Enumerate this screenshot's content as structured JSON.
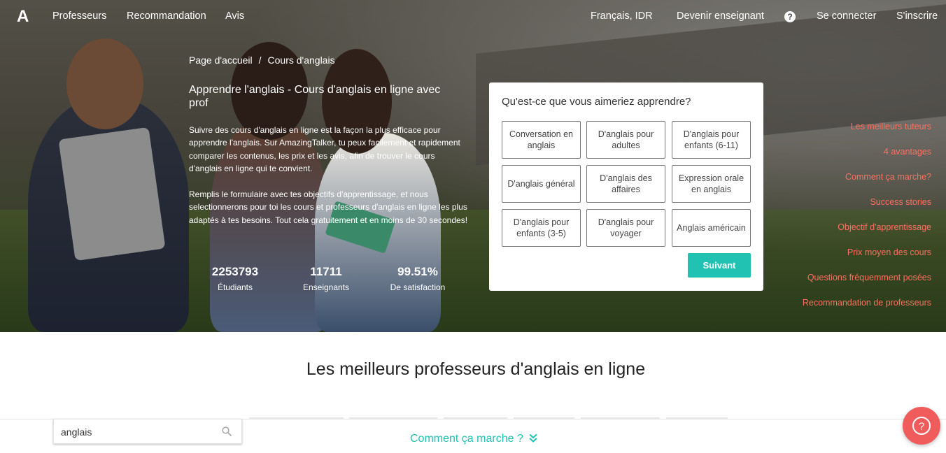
{
  "nav": {
    "logo": "A",
    "links": [
      "Professeurs",
      "Recommandation",
      "Avis"
    ],
    "language": "Français,  IDR",
    "become_teacher": "Devenir enseignant",
    "help": "?",
    "login": "Se connecter",
    "signup": "S'inscrire"
  },
  "breadcrumb": {
    "home": "Page d'accueil",
    "separator": "/",
    "current": "Cours d'anglais"
  },
  "hero": {
    "title": "Apprendre l'anglais - Cours d'anglais en ligne avec prof",
    "paragraph1": "Suivre des cours d'anglais en ligne est la façon la plus efficace pour apprendre l'anglais. Sur AmazingTalker, tu peux facilement et rapidement comparer les contenus, les prix et les avis, afin de trouver le cours d'anglais en ligne qui te convient.",
    "paragraph2": "Remplis le formulaire avec tes objectifs d'apprentissage, et nous selectionnerons pour toi les cours et professeurs d'anglais en ligne les plus adaptés à tes besoins. Tout cela gratuitement et en moins de 30 secondes!",
    "stats": [
      {
        "value": "2253793",
        "label": "Étudiants"
      },
      {
        "value": "11711",
        "label": "Enseignants"
      },
      {
        "value": "99.51%",
        "label": "De satisfaction"
      }
    ]
  },
  "form": {
    "question": "Qu'est-ce que vous aimeriez apprendre?",
    "options": [
      "Conversation en anglais",
      "D'anglais pour adultes",
      "D'anglais pour enfants (6-11)",
      "D'anglais général",
      "D'anglais des affaires",
      "Expression orale en anglais",
      "D'anglais pour enfants (3-5)",
      "D'anglais pour voyager",
      "Anglais américain"
    ],
    "next_label": "Suivant"
  },
  "side_nav": [
    "Les meilleurs tuteurs",
    "4 avantages",
    "Comment ça marche?",
    "Success stories",
    "Objectif d'apprentissage",
    "Prix moyen des cours",
    "Questions fréquemment posées",
    "Recommandation de professeurs"
  ],
  "section_title": "Les meilleurs professeurs d'anglais en ligne",
  "bottom": {
    "search_value": "anglais",
    "how_it_works": "Comment ça marche ?"
  },
  "colors": {
    "accent_teal": "#21c2b1",
    "side_link": "#ff6f61",
    "fab": "#f05c5c"
  },
  "icons": {
    "search": "search-icon",
    "help": "help-icon",
    "chevron": "double-chevron-down-icon",
    "fab": "help-circle-icon"
  }
}
